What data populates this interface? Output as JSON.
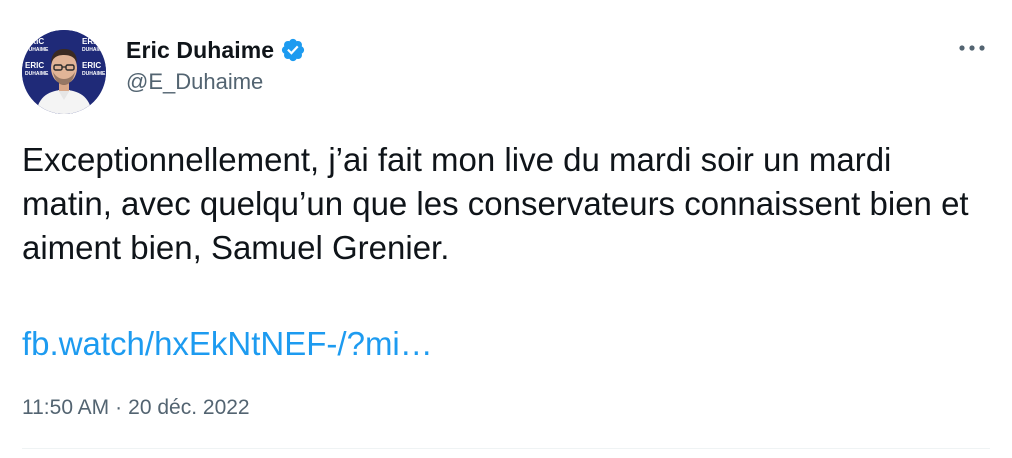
{
  "author": {
    "display_name": "Eric Duhaime",
    "handle": "@E_Duhaime",
    "verified": true,
    "avatar_backdrop_text": "ERIC DUHAIME"
  },
  "tweet": {
    "text": "Exceptionnellement, j’ai fait mon live du mardi soir un mardi matin, avec quelqu’un que les conservateurs connaissent bien et aiment bien, Samuel Grenier.",
    "link_text": "fb.watch/hxEkNtNEF-/?mi…"
  },
  "meta": {
    "time": "11:50 AM",
    "separator": "·",
    "date": "20 déc. 2022"
  },
  "icons": {
    "verified": "verified-badge-icon",
    "more": "more-options-icon"
  },
  "colors": {
    "link": "#1d9bf0",
    "secondary_text": "#536471",
    "primary_text": "#0f1419",
    "verified": "#1d9bf0"
  }
}
